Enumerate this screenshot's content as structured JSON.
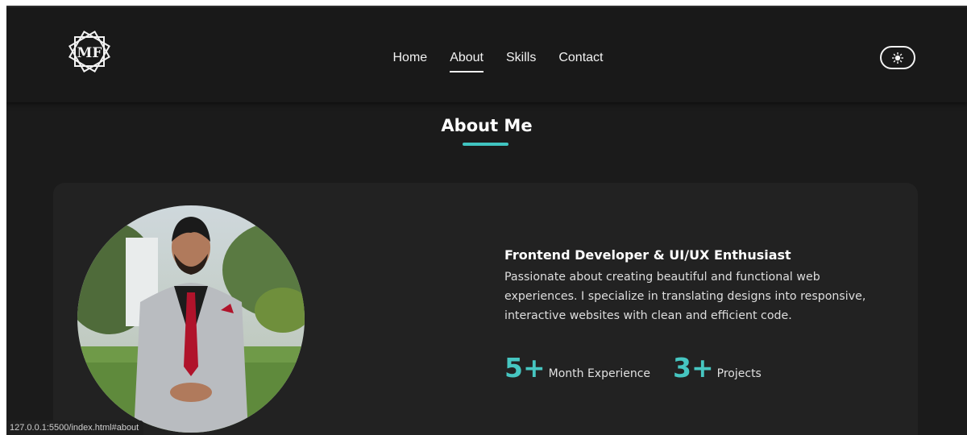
{
  "nav": {
    "logo_text": "MF",
    "links": [
      "Home",
      "About",
      "Skills",
      "Contact"
    ],
    "active": "About",
    "theme_toggle_icon": "sun-icon"
  },
  "about": {
    "title": "About Me",
    "heading": "Frontend Developer & UI/UX Enthusiast",
    "description": "Passionate about creating beautiful and functional web experiences. I specialize in translating designs into responsive, interactive websites with clean and efficient code.",
    "stats": [
      {
        "value": "5+",
        "label": "Month Experience"
      },
      {
        "value": "3+",
        "label": "Projects"
      }
    ]
  },
  "status_bar": {
    "url": "127.0.0.1:5500/index.html#about"
  },
  "colors": {
    "accent": "#40c4c0",
    "background": "#1b1b1b",
    "card": "#222222"
  }
}
